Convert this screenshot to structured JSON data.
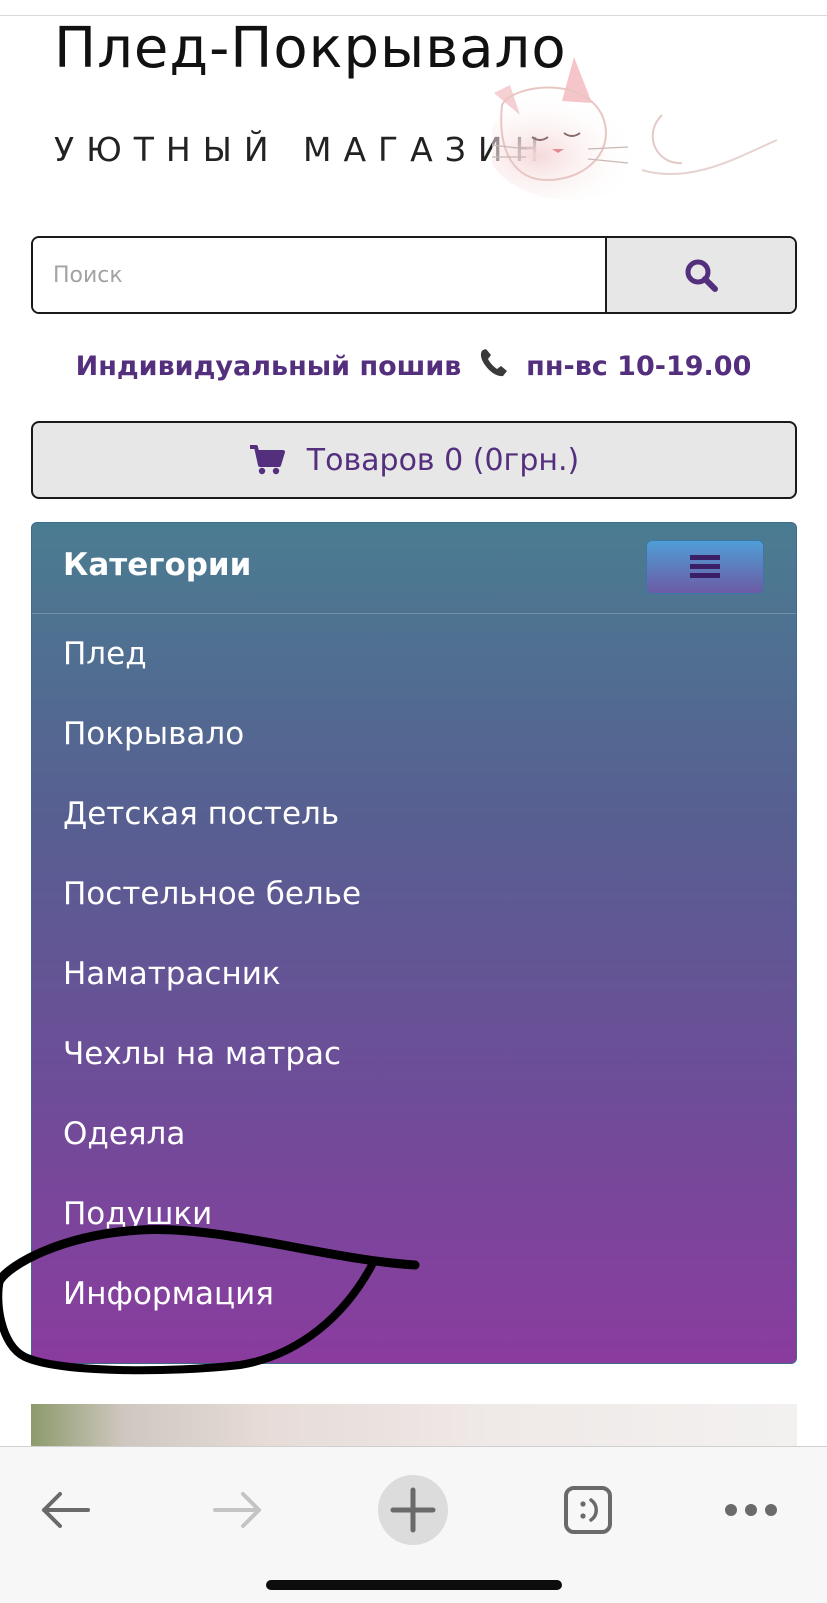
{
  "logo": {
    "title": "Плед-Покрывало",
    "subtitle": "УЮТНЫЙ МАГАЗИН",
    "image": "sleeping-cat-illustration"
  },
  "search": {
    "placeholder": "Поиск",
    "button_icon": "search-icon"
  },
  "info": {
    "left_text": "Индивидуальный пошив",
    "icon": "phone-icon",
    "right_text": "пн-вс 10-19.00"
  },
  "cart": {
    "icon": "cart-icon",
    "label": "Товаров 0 (0грн.)"
  },
  "categories": {
    "title": "Категории",
    "toggle_icon": "hamburger-menu-icon",
    "items": [
      {
        "label": "Плед"
      },
      {
        "label": "Покрывало"
      },
      {
        "label": "Детская постель"
      },
      {
        "label": "Постельное белье"
      },
      {
        "label": "Наматрасник"
      },
      {
        "label": "Чехлы на матрас"
      },
      {
        "label": "Одеяла"
      },
      {
        "label": "Подушки"
      },
      {
        "label": "Информация"
      }
    ]
  },
  "browser_toolbar": {
    "back_icon": "arrow-left-icon",
    "forward_icon": "arrow-right-icon",
    "new_tab_icon": "plus-icon",
    "tabs_icon": "tabs-smiley-icon",
    "more_icon": "more-dots-icon"
  },
  "colors": {
    "brand_purple": "#542f7d",
    "panel_top": "#4a7c91",
    "panel_bottom": "#8a3c9e",
    "button_grey": "#e7e7e7"
  }
}
